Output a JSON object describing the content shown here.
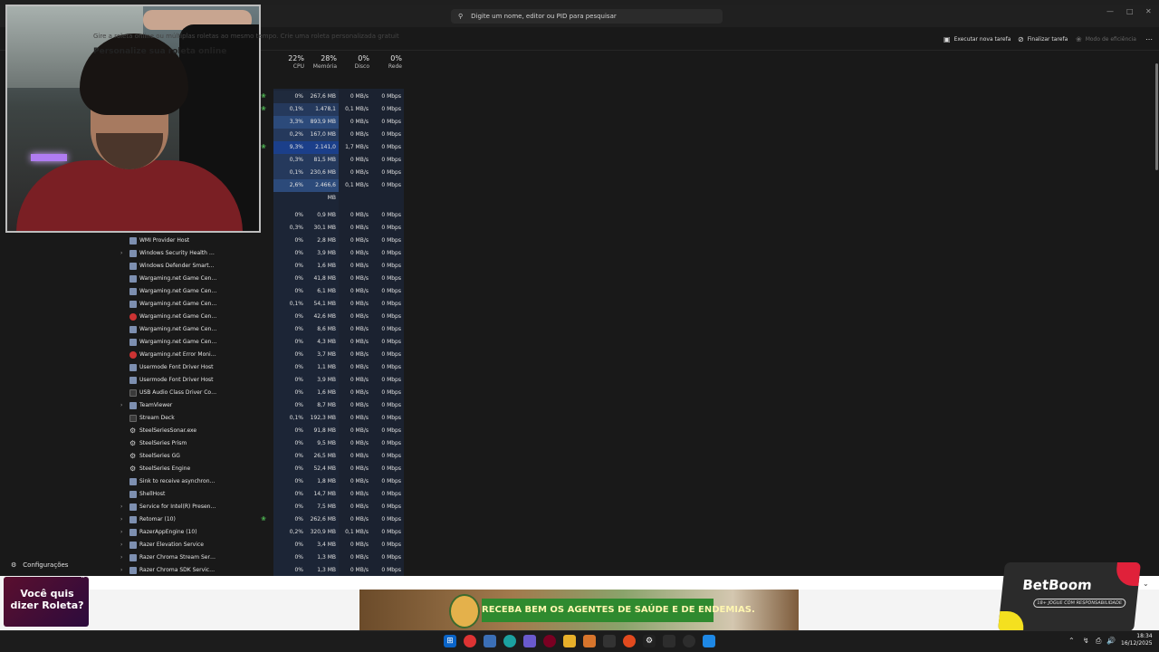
{
  "search": {
    "placeholder": "Digite um nome, editor ou PID para pesquisar"
  },
  "toolbar": {
    "new_task": "Executar nova tarefa",
    "end_task": "Finalizar tarefa",
    "efficiency": "Modo de eficiência"
  },
  "columns": [
    {
      "pct": "22%",
      "label": "CPU"
    },
    {
      "pct": "28%",
      "label": "Memória"
    },
    {
      "pct": "0%",
      "label": "Disco"
    },
    {
      "pct": "0%",
      "label": "Rede"
    }
  ],
  "sidebar": {
    "settings": "Configurações"
  },
  "top_rows": [
    {
      "cpu": "0%",
      "mem": "267,6 MB",
      "disk": "0 MB/s",
      "net": "0 Mbps",
      "leaf": true
    },
    {
      "cpu": "0,1%",
      "mem": "1.478,1 MB",
      "disk": "0,1 MB/s",
      "net": "0 Mbps",
      "leaf": true
    },
    {
      "cpu": "3,3%",
      "mem": "893,9 MB",
      "disk": "0 MB/s",
      "net": "0 Mbps",
      "leaf": false
    },
    {
      "cpu": "0,2%",
      "mem": "167,0 MB",
      "disk": "0 MB/s",
      "net": "0 Mbps",
      "leaf": false
    },
    {
      "cpu": "9,3%",
      "mem": "2.141,0 MB",
      "disk": "1,7 MB/s",
      "net": "0 Mbps",
      "leaf": true
    },
    {
      "cpu": "0,3%",
      "mem": "81,5 MB",
      "disk": "0 MB/s",
      "net": "0 Mbps",
      "leaf": false
    },
    {
      "cpu": "0,1%",
      "mem": "230,6 MB",
      "disk": "0 MB/s",
      "net": "0 Mbps",
      "leaf": false
    },
    {
      "cpu": "2,6%",
      "mem": "2.466,6 MB",
      "disk": "0,1 MB/s",
      "net": "0 Mbps",
      "leaf": false
    }
  ],
  "bg_rows": [
    {
      "name": "",
      "cpu": "0%",
      "mem": "0,9 MB",
      "disk": "0 MB/s",
      "net": "0 Mbps"
    },
    {
      "name": "",
      "cpu": "0,3%",
      "mem": "30,1 MB",
      "disk": "0 MB/s",
      "net": "0 Mbps"
    },
    {
      "name": "WMI Provider Host",
      "cpu": "0%",
      "mem": "2,8 MB",
      "disk": "0 MB/s",
      "net": "0 Mbps"
    },
    {
      "name": "Windows Security Health Servi...",
      "cpu": "0%",
      "mem": "3,9 MB",
      "disk": "0 MB/s",
      "net": "0 Mbps",
      "exp": true
    },
    {
      "name": "Windows Defender SmartScreen",
      "cpu": "0%",
      "mem": "1,6 MB",
      "disk": "0 MB/s",
      "net": "0 Mbps"
    },
    {
      "name": "Wargaming.net Game Center",
      "cpu": "0%",
      "mem": "41,8 MB",
      "disk": "0 MB/s",
      "net": "0 Mbps"
    },
    {
      "name": "Wargaming.net Game Center",
      "cpu": "0%",
      "mem": "6,1 MB",
      "disk": "0 MB/s",
      "net": "0 Mbps"
    },
    {
      "name": "Wargaming.net Game Center",
      "cpu": "0,1%",
      "mem": "54,1 MB",
      "disk": "0 MB/s",
      "net": "0 Mbps"
    },
    {
      "name": "Wargaming.net Game Center",
      "cpu": "0%",
      "mem": "42,6 MB",
      "disk": "0 MB/s",
      "net": "0 Mbps",
      "icon": "round"
    },
    {
      "name": "Wargaming.net Game Center",
      "cpu": "0%",
      "mem": "8,6 MB",
      "disk": "0 MB/s",
      "net": "0 Mbps"
    },
    {
      "name": "Wargaming.net Game Center",
      "cpu": "0%",
      "mem": "4,3 MB",
      "disk": "0 MB/s",
      "net": "0 Mbps"
    },
    {
      "name": "Wargaming.net Error Monitor",
      "cpu": "0%",
      "mem": "3,7 MB",
      "disk": "0 MB/s",
      "net": "0 Mbps",
      "icon": "round"
    },
    {
      "name": "Usermode Font Driver Host",
      "cpu": "0%",
      "mem": "1,1 MB",
      "disk": "0 MB/s",
      "net": "0 Mbps"
    },
    {
      "name": "Usermode Font Driver Host",
      "cpu": "0%",
      "mem": "3,9 MB",
      "disk": "0 MB/s",
      "net": "0 Mbps"
    },
    {
      "name": "USB Audio Class Driver Contro...",
      "cpu": "0%",
      "mem": "1,6 MB",
      "disk": "0 MB/s",
      "net": "0 Mbps",
      "icon": "dark"
    },
    {
      "name": "TeamViewer",
      "cpu": "0%",
      "mem": "8,7 MB",
      "disk": "0 MB/s",
      "net": "0 Mbps",
      "exp": true
    },
    {
      "name": "Stream Deck",
      "cpu": "0,1%",
      "mem": "192,3 MB",
      "disk": "0 MB/s",
      "net": "0 Mbps",
      "icon": "dark"
    },
    {
      "name": "SteelSeriesSonar.exe",
      "cpu": "0%",
      "mem": "91,8 MB",
      "disk": "0 MB/s",
      "net": "0 Mbps",
      "icon": "cog"
    },
    {
      "name": "SteelSeries Prism",
      "cpu": "0%",
      "mem": "9,5 MB",
      "disk": "0 MB/s",
      "net": "0 Mbps",
      "icon": "cog"
    },
    {
      "name": "SteelSeries GG",
      "cpu": "0%",
      "mem": "26,5 MB",
      "disk": "0 MB/s",
      "net": "0 Mbps",
      "icon": "cog"
    },
    {
      "name": "SteelSeries Engine",
      "cpu": "0%",
      "mem": "52,4 MB",
      "disk": "0 MB/s",
      "net": "0 Mbps",
      "icon": "cog"
    },
    {
      "name": "Sink to receive asynchronous ...",
      "cpu": "0%",
      "mem": "1,8 MB",
      "disk": "0 MB/s",
      "net": "0 Mbps"
    },
    {
      "name": "ShellHost",
      "cpu": "0%",
      "mem": "14,7 MB",
      "disk": "0 MB/s",
      "net": "0 Mbps"
    },
    {
      "name": "Service for Intel(R) PresentMo...",
      "cpu": "0%",
      "mem": "7,5 MB",
      "disk": "0 MB/s",
      "net": "0 Mbps",
      "exp": true
    },
    {
      "name": "Retomar (10)",
      "cpu": "0%",
      "mem": "262,6 MB",
      "disk": "0 MB/s",
      "net": "0 Mbps",
      "exp": true,
      "leaf": true
    },
    {
      "name": "RazerAppEngine (10)",
      "cpu": "0,2%",
      "mem": "320,9 MB",
      "disk": "0,1 MB/s",
      "net": "0 Mbps",
      "exp": true
    },
    {
      "name": "Razer Elevation Service",
      "cpu": "0%",
      "mem": "3,4 MB",
      "disk": "0 MB/s",
      "net": "0 Mbps",
      "exp": true
    },
    {
      "name": "Razer Chroma Stream Server (...",
      "cpu": "0%",
      "mem": "1,3 MB",
      "disk": "0 MB/s",
      "net": "0 Mbps",
      "exp": true
    },
    {
      "name": "Razer Chroma SDK Service Ho...",
      "cpu": "0%",
      "mem": "1,3 MB",
      "disk": "0 MB/s",
      "net": "0 Mbps",
      "exp": true
    }
  ],
  "banner": {
    "roleta": "Você quis dizer Roleta?",
    "text": "Gire a roleta online ou múltiplas roletas ao mesmo tempo. Crie uma roleta personalizada gratuit",
    "title": "Personalize sua roleta online",
    "ad": "RECEBA BEM OS AGENTES DE SAÚDE E DE ENDEMIAS.",
    "brand": "BetBoom",
    "age": "18+ JOGUE COM RESPONSABILIDADE"
  },
  "taskbar": {
    "time": "18:34",
    "date": "16/12/2025"
  }
}
